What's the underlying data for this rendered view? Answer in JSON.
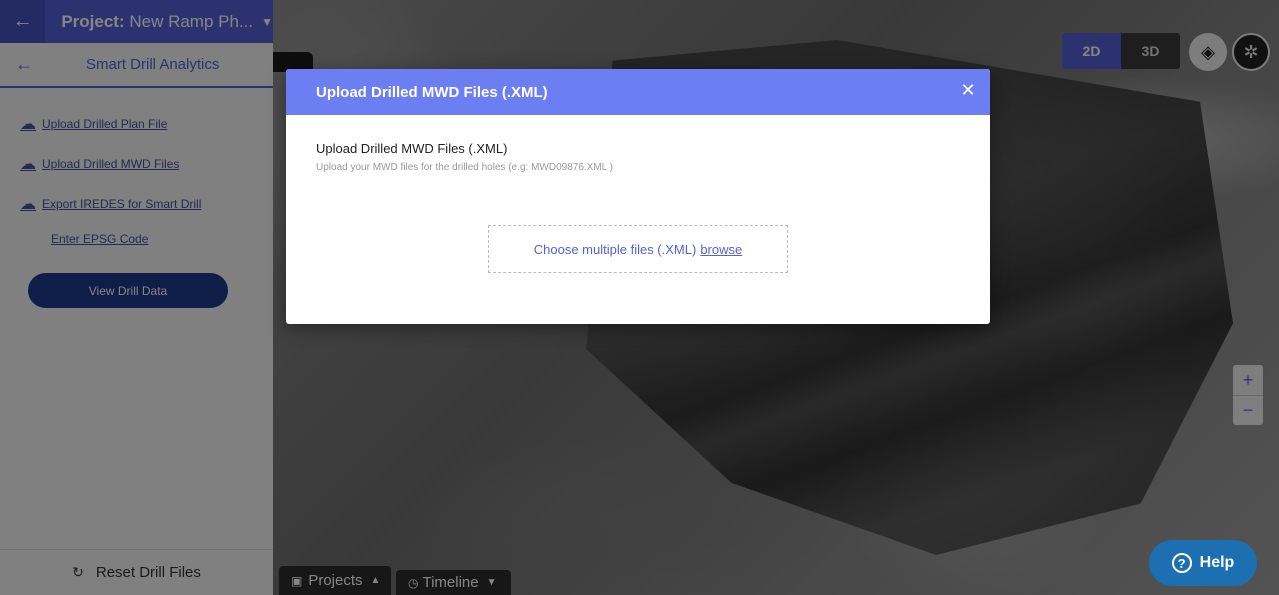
{
  "project": {
    "label": "Project:",
    "name": "New Ramp Ph..."
  },
  "panel": {
    "title": "Smart Drill Analytics",
    "links": [
      "Upload Drilled Plan File",
      "Upload Drilled MWD Files",
      "Export IREDES for Smart Drill",
      "Enter EPSG Code"
    ],
    "view_button": "View Drill Data",
    "reset": "Reset Drill Files"
  },
  "map": {
    "toggle_2d": "2D",
    "toggle_3d": "3D",
    "zoom_in": "+",
    "zoom_out": "−",
    "projects_tab": "Projects",
    "timeline_tab": "Timeline",
    "help": "Help"
  },
  "modal": {
    "title": "Upload Drilled MWD Files (.XML)",
    "field_label": "Upload Drilled MWD Files (.XML)",
    "field_help": "Upload your MWD files for the drilled holes (e.g: MWD09876.XML )",
    "dropzone_text": "Choose multiple files (.XML)",
    "browse": "browse"
  },
  "colors": {
    "accent": "#5561d6",
    "modal_header": "#6c7ff2",
    "view_button": "#1e3a8a",
    "help_button": "#1c6fb0"
  }
}
